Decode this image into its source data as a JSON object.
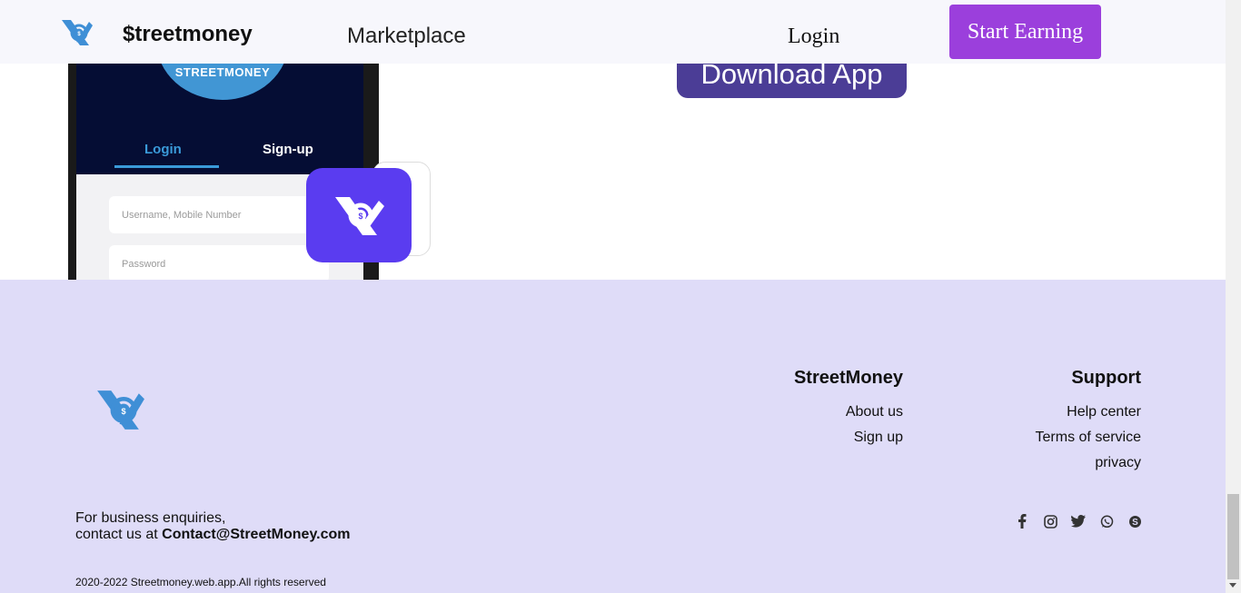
{
  "header": {
    "brand": "$treetmoney",
    "nav_marketplace": "Marketplace",
    "nav_login": "Login",
    "cta": "Start Earning"
  },
  "hero": {
    "phone": {
      "circle_label": "STREETMONEY",
      "tab_login": "Login",
      "tab_signup": "Sign-up",
      "username_placeholder": "Username, Mobile Number",
      "password_placeholder": "Password"
    },
    "download_button": "Download App"
  },
  "footer": {
    "col_streetmoney": {
      "title": "StreetMoney",
      "links": [
        "About us",
        "Sign up"
      ]
    },
    "col_support": {
      "title": "Support",
      "links": [
        "Help center",
        "Terms of service",
        "privacy"
      ]
    },
    "enquiry_line1": "For business enquiries,",
    "enquiry_prefix": "contact us at ",
    "enquiry_email": "Contact@StreetMoney.com",
    "socials": [
      "facebook-icon",
      "instagram-icon",
      "twitter-icon",
      "whatsapp-icon",
      "skype-icon"
    ],
    "copyright": "2020-2022 Streetmoney.web.app.All rights reserved"
  },
  "colors": {
    "accent_purple": "#9b3fdc",
    "download_purple": "#4b3d96",
    "footer_bg": "#dfdcf8",
    "logo_blue": "#3f8fd6"
  }
}
